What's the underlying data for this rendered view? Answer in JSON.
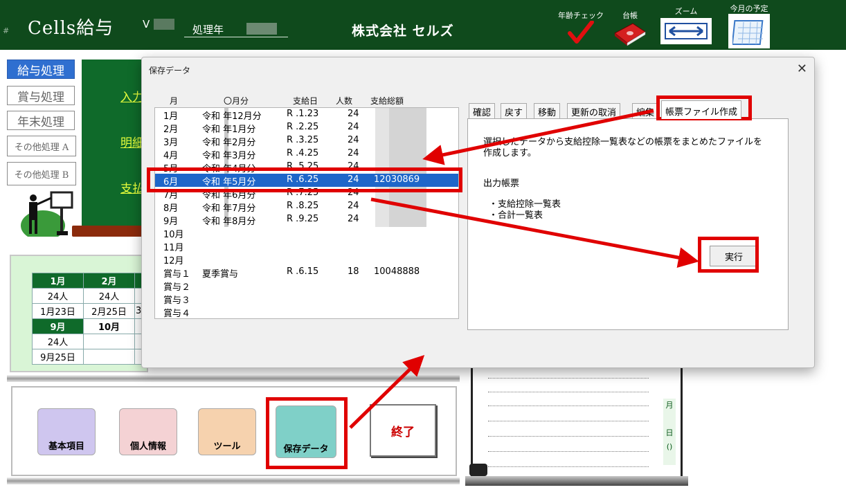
{
  "header": {
    "hash": "#",
    "app_title": "Cells給与",
    "version_prefix": "V",
    "year_label": "処理年",
    "company": "株式会社 セルズ",
    "tools": {
      "age_check": "年齢チェック",
      "ledger": "台帳",
      "zoom": "ズーム",
      "schedule": "今月の予定"
    }
  },
  "sidebar": {
    "items": [
      {
        "label": "給与処理",
        "active": true
      },
      {
        "label": "賞与処理"
      },
      {
        "label": "年末処理"
      },
      {
        "label": "その他処理 A"
      },
      {
        "label": "その他処理 B"
      }
    ]
  },
  "panel_links": [
    "入力",
    "明細",
    "支払"
  ],
  "calendar": {
    "row1_headers": [
      "1月",
      "2月"
    ],
    "row1_counts": [
      "24人",
      "24人"
    ],
    "row1_dates": [
      "1月23日",
      "2月25日",
      "3"
    ],
    "row2_headers": [
      "9月",
      "10月"
    ],
    "row2_counts": [
      "24人",
      ""
    ],
    "row2_dates": [
      "9月25日",
      ""
    ]
  },
  "bottom_buttons": {
    "basic": "基本項目",
    "personal": "個人情報",
    "tool": "ツール",
    "save_data": "保存データ",
    "exit": "終了"
  },
  "notebook": {
    "side": [
      "月",
      "日",
      "()"
    ]
  },
  "dialog": {
    "title": "保存データ",
    "close": "✕",
    "columns": [
      "月",
      "〇月分",
      "支給日",
      "人数",
      "支給総額"
    ],
    "rows": [
      {
        "month": "1月",
        "period": "令和 年12月分",
        "date": "R .1.23",
        "count": "24",
        "total": ""
      },
      {
        "month": "2月",
        "period": "令和 年1月分",
        "date": "R .2.25",
        "count": "24",
        "total": ""
      },
      {
        "month": "3月",
        "period": "令和 年2月分",
        "date": "R .3.25",
        "count": "24",
        "total": ""
      },
      {
        "month": "4月",
        "period": "令和 年3月分",
        "date": "R .4.25",
        "count": "24",
        "total": ""
      },
      {
        "month": "5月",
        "period": "令和 年4月分",
        "date": "R .5.25",
        "count": "24",
        "total": ""
      },
      {
        "month": "6月",
        "period": "令和 年5月分",
        "date": "R .6.25",
        "count": "24",
        "total": "12030869",
        "selected": true
      },
      {
        "month": "7月",
        "period": "令和 年6月分",
        "date": "R .7.25",
        "count": "24",
        "total": ""
      },
      {
        "month": "8月",
        "period": "令和 年7月分",
        "date": "R .8.25",
        "count": "24",
        "total": ""
      },
      {
        "month": "9月",
        "period": "令和 年8月分",
        "date": "R .9.25",
        "count": "24",
        "total": ""
      },
      {
        "month": "10月",
        "period": "",
        "date": "",
        "count": "",
        "total": ""
      },
      {
        "month": "11月",
        "period": "",
        "date": "",
        "count": "",
        "total": ""
      },
      {
        "month": "12月",
        "period": "",
        "date": "",
        "count": "",
        "total": ""
      },
      {
        "month": "賞与１",
        "period": "夏季賞与",
        "date": "R .6.15",
        "count": "18",
        "total": "10048888"
      },
      {
        "month": "賞与２",
        "period": "",
        "date": "",
        "count": "",
        "total": ""
      },
      {
        "month": "賞与３",
        "period": "",
        "date": "",
        "count": "",
        "total": ""
      },
      {
        "month": "賞与４",
        "period": "",
        "date": "",
        "count": "",
        "total": ""
      }
    ],
    "tabs": [
      "確認",
      "戻す",
      "移動",
      "更新の取消",
      "編集",
      "帳票ファイル作成"
    ],
    "active_tab": "帳票ファイル作成",
    "description": "選択したデータから支給控除一覧表などの帳票をまとめたファイルを作成します。",
    "output_title": "出力帳票",
    "output_items": [
      "・支給控除一覧表",
      "・合計一覧表"
    ],
    "execute": "実行"
  },
  "colors": {
    "header_bg": "#0f4a1c",
    "panel_green": "#0f6a2a",
    "selection_blue": "#1e66c9",
    "annotation_red": "#e00000",
    "active_nav": "#2f6fd0"
  }
}
